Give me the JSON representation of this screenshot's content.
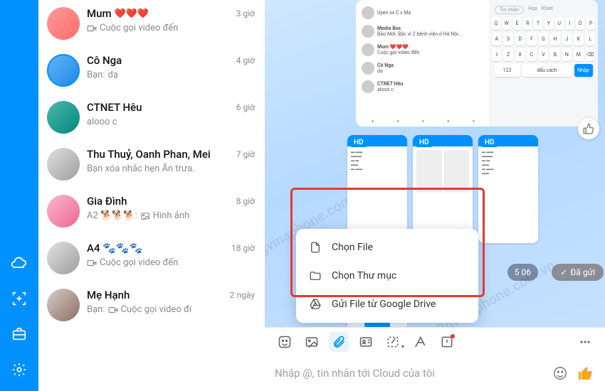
{
  "chats": [
    {
      "title": "Mum",
      "hearts": "❤️❤️❤️",
      "sub_prefix": "",
      "sub_icon": "video",
      "sub": "Cuộc gọi video đến",
      "time": "3 giờ",
      "avatar": "red"
    },
    {
      "title": "Cô Nga",
      "hearts": "",
      "sub_prefix": "Bạn: ",
      "sub_icon": "",
      "sub": "dạ",
      "time": "4 giờ",
      "avatar": "blue",
      "bordered": true
    },
    {
      "title": "CTNET Hêu",
      "hearts": "",
      "sub_prefix": "",
      "sub_icon": "",
      "sub": "alooo c",
      "time": "6 giờ",
      "avatar": "teal"
    },
    {
      "title": "Thu Thuỷ, Oanh Phan, Mei",
      "hearts": "",
      "sub_prefix": "",
      "sub_icon": "",
      "sub": "Bạn xóa nhắc hẹn Ăn trưa.",
      "time": "7 giờ",
      "avatar": "grey"
    },
    {
      "title": "Gia Đình",
      "hearts": "",
      "sub_prefix": "A2 🐕🐕🐕: ",
      "sub_icon": "image",
      "sub": "Hình ảnh",
      "time": "8 giờ",
      "avatar": "pink"
    },
    {
      "title": "A4 🐾🐾🐾",
      "hearts": "",
      "sub_prefix": "",
      "sub_icon": "video",
      "sub": "Cuộc gọi video đến",
      "time": "18 giờ",
      "avatar": "grey"
    },
    {
      "title": "Mẹ Hạnh",
      "hearts": "",
      "sub_prefix": "Bạn: ",
      "sub_icon": "video",
      "sub": "Cuộc gọi video đi",
      "time": "2 ngày",
      "avatar": "brown"
    }
  ],
  "attach_menu": {
    "items": [
      {
        "icon": "file",
        "label": "Chọn File"
      },
      {
        "icon": "folder",
        "label": "Chọn Thư mục"
      },
      {
        "icon": "drive",
        "label": "Gửi File từ Google Drive"
      }
    ]
  },
  "hd_label": "HD",
  "status": {
    "sent": "Đã gửi",
    "time": "5 06"
  },
  "input": {
    "placeholder": "Nhập @, tin nhắn tới Cloud của tôi"
  },
  "watermark": "3gvinaphone.com.vn",
  "keyboard": {
    "row1": [
      "Q",
      "W",
      "E",
      "R",
      "T",
      "Y",
      "U",
      "I",
      "O",
      "P"
    ],
    "row2": [
      "A",
      "S",
      "D",
      "F",
      "G",
      "H",
      "J",
      "K",
      "L"
    ],
    "row3": [
      "Z",
      "X",
      "C",
      "V",
      "B",
      "N",
      "M"
    ],
    "space": "dấu cách",
    "enter": "Nhập",
    "hqa": "Hqa",
    "kbiet": "Kbiet"
  },
  "preview_chats": [
    {
      "title": "Uyen xx C x Ma"
    },
    {
      "title": "Media Box",
      "sub": "Bảo Mới: Bắc xí 2 bệnh viện ở Hà Nội..."
    },
    {
      "title": "Mum ❤️❤️❤️",
      "sub": "Cuộc gọi video đến"
    },
    {
      "title": "Cô Nga",
      "sub": "dạ"
    },
    {
      "title": "CTNET Hêu",
      "sub": "alooo c"
    }
  ]
}
